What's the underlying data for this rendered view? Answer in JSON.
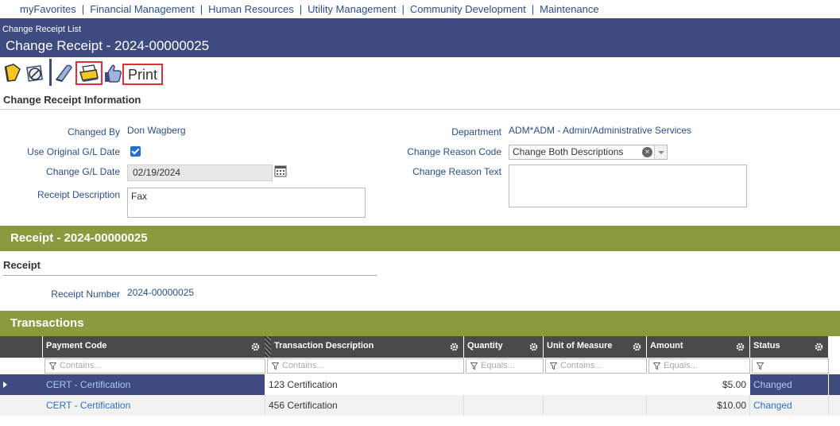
{
  "nav": {
    "items": [
      "myFavorites",
      "Financial Management",
      "Human Resources",
      "Utility Management",
      "Community Development",
      "Maintenance"
    ]
  },
  "header": {
    "breadcrumb": "Change Receipt List",
    "title": "Change Receipt - 2024-00000025"
  },
  "toolbar": {
    "print_label": "Print",
    "icons": [
      "save-icon",
      "cancel-icon",
      "edit-icon",
      "print-icon",
      "approve-icon"
    ]
  },
  "info": {
    "section_title": "Change Receipt Information",
    "changed_by_label": "Changed By",
    "changed_by": "Don Wagberg",
    "use_original_label": "Use Original G/L Date",
    "use_original_checked": true,
    "change_gl_date_label": "Change G/L Date",
    "change_gl_date": "02/19/2024",
    "receipt_description_label": "Receipt Description",
    "receipt_description": "Fax",
    "department_label": "Department",
    "department": "ADM*ADM - Admin/Administrative Services",
    "change_reason_code_label": "Change Reason Code",
    "change_reason_code": "Change Both Descriptions",
    "change_reason_text_label": "Change Reason Text",
    "change_reason_text": ""
  },
  "receipt": {
    "band_title": "Receipt - 2024-00000025",
    "section_title": "Receipt",
    "receipt_number_label": "Receipt Number",
    "receipt_number": "2024-00000025"
  },
  "transactions": {
    "band_title": "Transactions",
    "columns": [
      "Payment Code",
      "Transaction Description",
      "Quantity",
      "Unit of Measure",
      "Amount",
      "Status"
    ],
    "filters": [
      "Contains...",
      "Contains...",
      "Equals...",
      "Contains...",
      "Equals...",
      ""
    ],
    "rows": [
      {
        "payment_code": "CERT - Certification",
        "description": "123 Certification",
        "quantity": "",
        "unit": "",
        "amount": "$5.00",
        "status": "Changed"
      },
      {
        "payment_code": "CERT - Certification",
        "description": "456 Certification",
        "quantity": "",
        "unit": "",
        "amount": "$10.00",
        "status": "Changed"
      }
    ]
  },
  "colors": {
    "header_bg": "#3e4a80",
    "band_green": "#8a9a3f",
    "link_blue": "#2b4e8c",
    "highlight_red": "#e0303a"
  }
}
